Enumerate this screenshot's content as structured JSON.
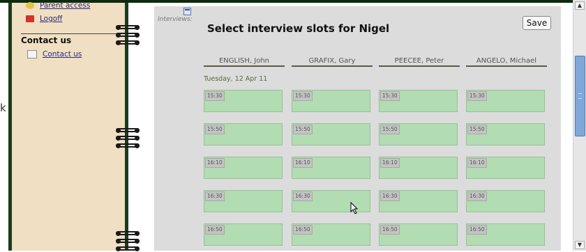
{
  "sidebar": {
    "links": [
      {
        "label": "Parent access",
        "icon": "parent-access-icon"
      },
      {
        "label": "Logoff",
        "icon": "logoff-icon"
      }
    ],
    "contact_heading": "Contact us",
    "contact_link": {
      "label": "Contact us",
      "icon": "mail-icon"
    }
  },
  "main": {
    "section_label": "Interviews:",
    "title": "Select interview slots for Nigel",
    "save_label": "Save",
    "date": "Tuesday, 12 Apr 11",
    "teachers": [
      "ENGLISH, John",
      "GRAFIX, Gary",
      "PEECEE, Peter",
      "ANGELO, Michael"
    ],
    "time_slots": [
      "15:30",
      "15:50",
      "16:10",
      "16:30",
      "16:50"
    ]
  },
  "colors": {
    "sidebar_bg": "#f0dfc2",
    "panel_bg": "#dcdcdc",
    "slot_bg": "#b2dcb2",
    "ring_color": "#1a1a1a"
  },
  "stray_text": "k"
}
